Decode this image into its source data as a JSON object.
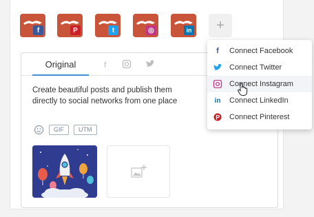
{
  "accounts": [
    {
      "name": "facebook-account",
      "badge": "f",
      "badge_color": "#3b5998"
    },
    {
      "name": "pinterest-account",
      "badge": "P",
      "badge_color": "#cb2027"
    },
    {
      "name": "twitter-account",
      "badge": "t",
      "badge_color": "#1da1f2"
    },
    {
      "name": "instagram-account",
      "badge": "◎",
      "badge_color": "#c13584"
    },
    {
      "name": "linkedin-account",
      "badge": "in",
      "badge_color": "#0077b5"
    }
  ],
  "add_account": {
    "icon": "plus-icon",
    "label": "+"
  },
  "editor": {
    "tabs": {
      "original": "Original",
      "icons": [
        "facebook-icon",
        "instagram-icon",
        "twitter-icon"
      ]
    },
    "post_text": "Create beautiful posts and publish them\ndirectly to social networks from one place",
    "tools": {
      "gif": "GIF",
      "utm": "UTM",
      "emoji_icon": "emoji-icon"
    },
    "media": {
      "thumbnail": "rocket-illustration",
      "add_icon": "add-image-icon"
    }
  },
  "dropdown": {
    "items": [
      {
        "label": "Connect Facebook",
        "icon": "facebook-icon",
        "glyph": "f",
        "color": "#3b5998"
      },
      {
        "label": "Connect Twitter",
        "icon": "twitter-icon",
        "glyph": "🐦",
        "color": "#1da1f2"
      },
      {
        "label": "Connect Instagram",
        "icon": "instagram-icon",
        "glyph": "◎",
        "color": "#c13584"
      },
      {
        "label": "Connect LinkedIn",
        "icon": "linkedin-icon",
        "glyph": "in",
        "color": "#0077b5"
      },
      {
        "label": "Connect Pinterest",
        "icon": "pinterest-icon",
        "glyph": "P",
        "color": "#cb2027"
      }
    ]
  },
  "colors": {
    "account_bg": "#c8553a",
    "tab_accent": "#3d8ed6"
  }
}
